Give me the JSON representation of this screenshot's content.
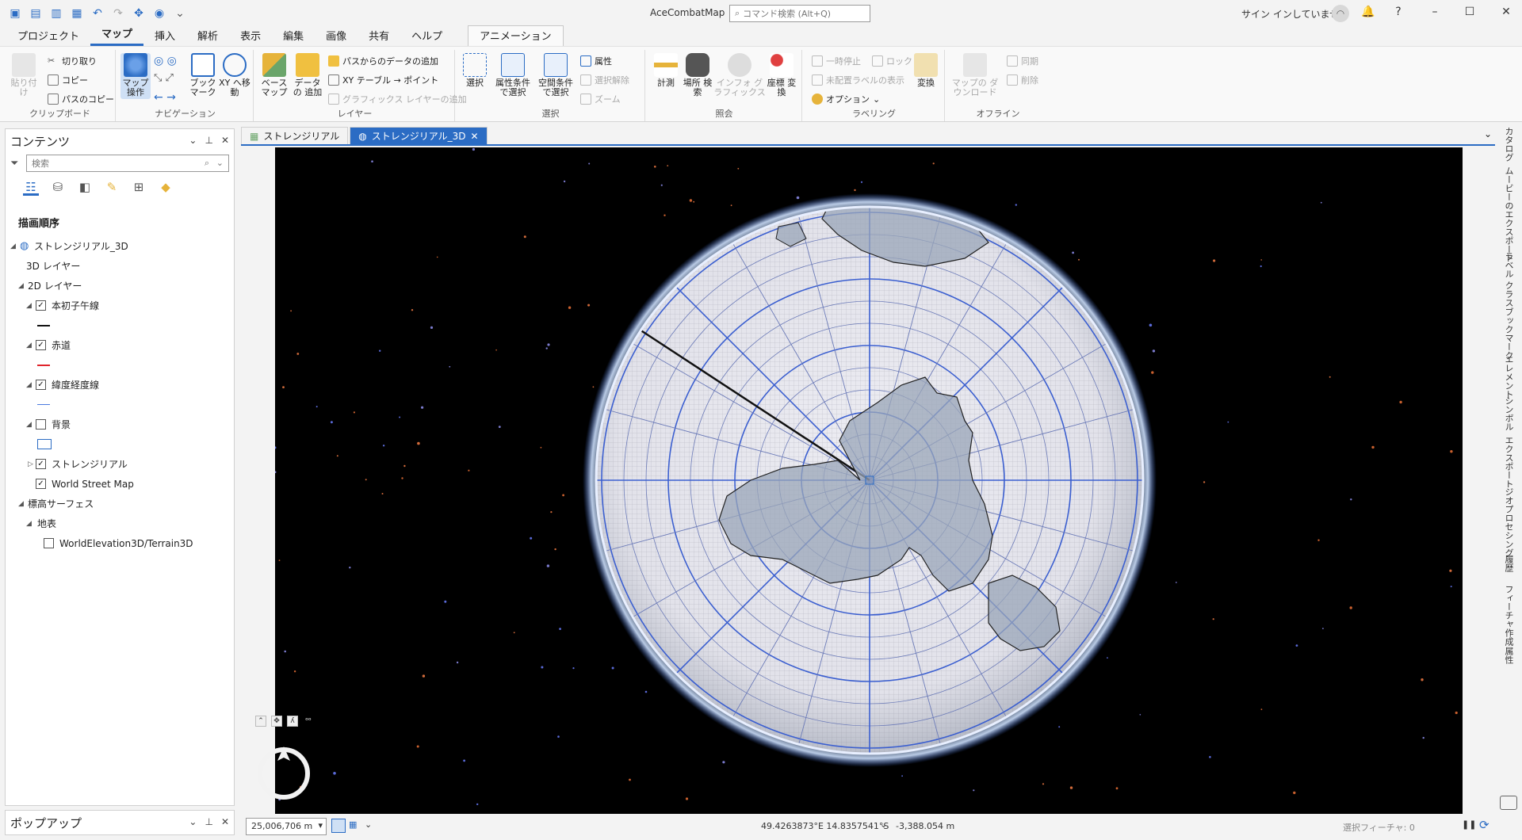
{
  "app": {
    "title": "AceCombatMap",
    "command_search_placeholder": "コマンド検索 (Alt+Q)",
    "signin": "サイン インしていません",
    "help": "?"
  },
  "ribbon_tabs": [
    "プロジェクト",
    "マップ",
    "挿入",
    "解析",
    "表示",
    "編集",
    "画像",
    "共有",
    "ヘルプ",
    "アニメーション"
  ],
  "ribbon": {
    "clipboard": {
      "label": "クリップボード",
      "paste": "貼り付け",
      "cut": "切り取り",
      "copy": "コピー",
      "copy_path": "パスのコピー"
    },
    "navigation": {
      "label": "ナビゲーション",
      "explore": "マップ 操作",
      "bookmark": "ブック マーク",
      "xy": "XY へ移動"
    },
    "layer": {
      "label": "レイヤー",
      "basemap": "ベース マップ",
      "add_data": "データの 追加",
      "add_from_path": "パスからのデータの追加",
      "xy_table": "XY テーブル → ポイント",
      "add_graphics": "グラフィックス レイヤーの追加"
    },
    "selection": {
      "label": "選択",
      "select": "選択",
      "by_attr": "属性条件 で選択",
      "by_loc": "空間条件 で選択",
      "attributes": "属性",
      "clear": "選択解除",
      "zoom": "ズーム"
    },
    "inquiry": {
      "label": "照会",
      "measure": "計測",
      "locate": "場所 検索",
      "infographics": "インフォ グラフィックス",
      "convert_coords": "座標 変換"
    },
    "labeling": {
      "label": "ラベリング",
      "pause": "一時停止",
      "lock": "ロック",
      "unplaced": "未配置ラベルの表示",
      "options": "オプション",
      "convert": "変換"
    },
    "offline": {
      "label": "オフライン",
      "download": "マップの ダウンロード",
      "sync": "同期",
      "remove": "削除"
    }
  },
  "contents": {
    "title": "コンテンツ",
    "search_placeholder": "検索",
    "draw_order": "描画順序",
    "scene": "ストレンジリアル_3D",
    "layers_3d": "3D レイヤー",
    "layers_2d": "2D レイヤー",
    "prime_meridian": "本初子午線",
    "equator": "赤道",
    "graticule": "緯度経度線",
    "background": "背景",
    "strangereal": "ストレンジリアル",
    "world_street_map": "World Street Map",
    "elevation_surfaces": "標高サーフェス",
    "ground": "地表",
    "terrain": "WorldElevation3D/Terrain3D"
  },
  "popup": {
    "title": "ポップアップ"
  },
  "map_tabs": [
    {
      "label": "ストレンジリアル"
    },
    {
      "label": "ストレンジリアル_3D"
    }
  ],
  "right_bar": [
    "カタログ",
    "ムービーのエクスポート",
    "ラベル クラス",
    "ブックマーク",
    "エレメント",
    "シンボル",
    "エクスポート",
    "ジオプロセシング",
    "履歴",
    "フィーチャ作成",
    "属性"
  ],
  "status": {
    "scale": "25,006,706 m",
    "coords": "49.4263873°E 14.8357541°S",
    "elevation": "-3,388.054 m",
    "selected_features": "選択フィーチャ: 0"
  },
  "colors": {
    "accent": "#2b6cc4",
    "prime_meridian": "#111111",
    "equator": "#e0242c",
    "graticule": "#4a7ae0",
    "space": "#000000"
  },
  "icons": [
    "new-project-icon",
    "open-icon",
    "save-icon",
    "undo-icon",
    "redo-icon",
    "explore-icon",
    "notification-icon"
  ]
}
